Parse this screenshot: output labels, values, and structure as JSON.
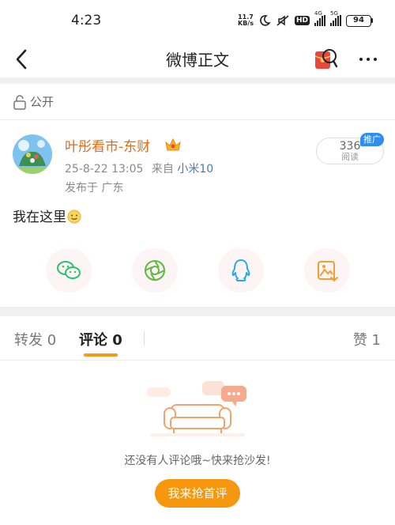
{
  "status_bar": {
    "time": "4:23",
    "net_speed_value": "11.7",
    "net_speed_unit": "KB/s",
    "hd_label": "HD",
    "signal_1_tag": "4G",
    "signal_2_tag": "5G",
    "battery": "94",
    "icons": [
      "moon-icon",
      "mute-icon",
      "signal-icon",
      "battery-icon"
    ]
  },
  "nav": {
    "title": "微博正文",
    "icons": [
      "back-icon",
      "red-packet-icon",
      "more-icon"
    ]
  },
  "visibility": {
    "label": "公开",
    "icon": "lock-open-icon"
  },
  "post": {
    "author": "叶彤看市-东财",
    "timestamp": "25-8-22 13:05",
    "source_prefix": "来自",
    "source": "小米10",
    "location": "发布于 广东",
    "read_count": "336",
    "read_label": "阅读",
    "promo_tag": "推广",
    "body": "我在这里"
  },
  "share": {
    "icons": [
      "wechat-icon",
      "moments-icon",
      "qq-icon",
      "save-image-icon"
    ]
  },
  "tabs": [
    {
      "label": "转发 0"
    },
    {
      "label": "评论 0"
    },
    {
      "label": "赞 1"
    }
  ],
  "empty_state": {
    "text": "还没有人评论哦~快来抢沙发!",
    "button": "我来抢首评"
  },
  "colors": {
    "accent_orange": "#f7970e",
    "author_orange": "#e86a12",
    "link_blue": "#4a7ab4",
    "promo_blue": "#2d8df3",
    "wechat_green": "#2dc26e",
    "qq_blue": "#26a9e8"
  }
}
